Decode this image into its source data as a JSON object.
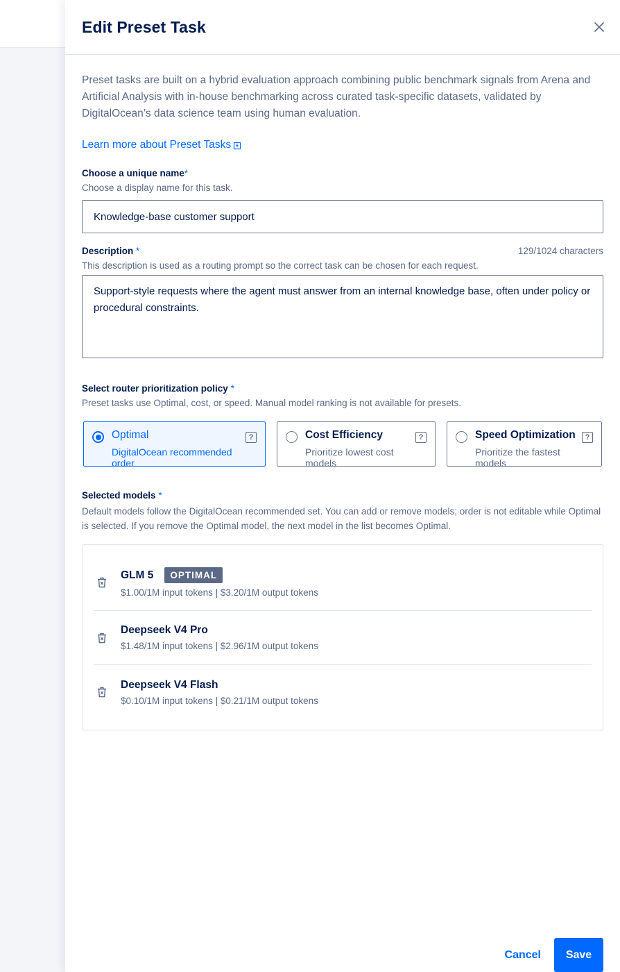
{
  "panel": {
    "title": "Edit Preset Task",
    "intro": "Preset tasks are built on a hybrid evaluation approach combining public benchmark signals from Arena and Artificial Analysis with in-house benchmarking across curated task-specific datasets, validated by DigitalOcean’s data science team using human evaluation.",
    "learn_more": "Learn more about Preset Tasks"
  },
  "name_field": {
    "label": "Choose a unique name",
    "required": "*",
    "help": "Choose a display name for this task.",
    "value": "Knowledge-base customer support"
  },
  "description_field": {
    "label": "Description",
    "required": "*",
    "char_count": "129/1024 characters",
    "help": "This description is used as a routing prompt so the correct task can be chosen for each request.",
    "value": "Support-style requests where the agent must answer from an internal knowledge base, often under policy or procedural constraints."
  },
  "policy": {
    "label": "Select router prioritization policy",
    "required": "*",
    "help": "Preset tasks use Optimal, cost, or speed. Manual model ranking is not available for presets.",
    "options": [
      {
        "title": "Optimal",
        "subtitle": "DigitalOcean recommended order",
        "selected": true
      },
      {
        "title": "Cost Efficiency",
        "subtitle": "Prioritize lowest cost models",
        "selected": false
      },
      {
        "title": "Speed Optimization",
        "subtitle": "Prioritize the fastest models",
        "selected": false
      }
    ],
    "help_glyph": "?"
  },
  "models": {
    "label": "Selected models",
    "required": "*",
    "help": "Default models follow the DigitalOcean recommended set. You can add or remove models; order is not editable while Optimal is selected. If you remove the Optimal model, the next model in the list becomes Optimal.",
    "items": [
      {
        "name": "GLM 5",
        "badge": "OPTIMAL",
        "price": "$1.00/1M input tokens | $3.20/1M output tokens"
      },
      {
        "name": "Deepseek V4 Pro",
        "price": "$1.48/1M input tokens | $2.96/1M output tokens"
      },
      {
        "name": "Deepseek V4 Flash",
        "price": "$0.10/1M input tokens | $0.21/1M output tokens"
      }
    ]
  },
  "footer": {
    "cancel": "Cancel",
    "save": "Save"
  },
  "icons": {
    "close": "close-icon",
    "external_link": "external-link-icon",
    "trash": "trash-icon",
    "help": "help-icon"
  },
  "colors": {
    "primary": "#0069ff",
    "text": "#031b4e",
    "muted": "#5b6987",
    "badge_bg": "#5b6987"
  }
}
